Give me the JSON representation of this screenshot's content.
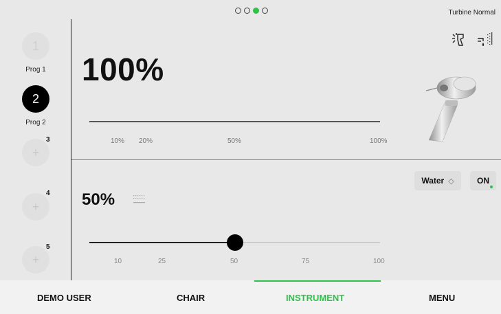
{
  "header": {
    "page_dots": [
      false,
      false,
      true,
      false
    ],
    "status": "Turbine Normal"
  },
  "programs": [
    {
      "label": "1",
      "name": "Prog 1",
      "state": "inactive"
    },
    {
      "label": "2",
      "name": "Prog 2",
      "state": "active"
    },
    {
      "label": "+",
      "badge": "3",
      "state": "add"
    },
    {
      "label": "+",
      "badge": "4",
      "state": "add"
    },
    {
      "label": "+",
      "badge": "5",
      "state": "add"
    }
  ],
  "speed": {
    "value": "100%",
    "ticks": [
      "10%",
      "20%",
      "50%",
      "100%"
    ],
    "level": 1.0
  },
  "spray": {
    "value": "50%",
    "ticks": [
      "10",
      "25",
      "50",
      "75",
      "100"
    ],
    "level": 0.5,
    "medium": "Water",
    "medium_arrows": "◇",
    "toggle": "ON"
  },
  "colors": {
    "accent": "#2ec24a",
    "background": "#e8e8e8"
  },
  "icons": {
    "light": "light-icon",
    "spray": "spray-icon",
    "handpiece": "handpiece-icon",
    "air": "air-icon"
  },
  "nav": {
    "items": [
      "DEMO USER",
      "CHAIR",
      "INSTRUMENT",
      "MENU"
    ],
    "active": 2
  }
}
